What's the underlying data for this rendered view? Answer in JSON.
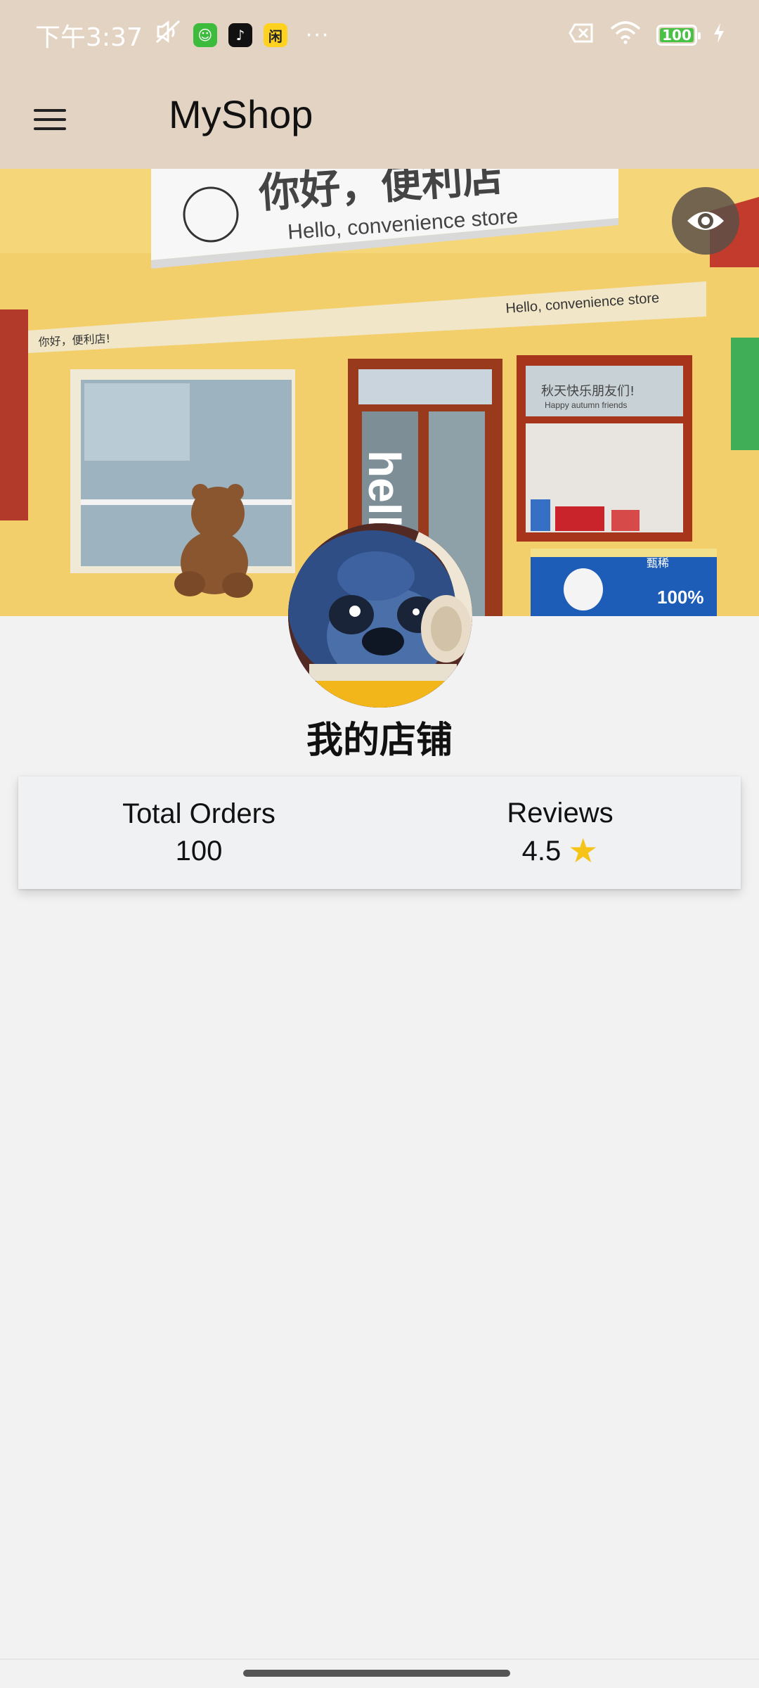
{
  "status_bar": {
    "time": "下午3:37",
    "battery_level": "100",
    "more_dots": "···",
    "icons": [
      "mute-icon",
      "wechat-app-icon",
      "tiktok-app-icon",
      "xianyu-app-icon",
      "sim-off-icon",
      "wifi-icon",
      "battery-icon",
      "charging-icon"
    ]
  },
  "app_bar": {
    "title": "MyShop",
    "menu_icon": "hamburger-menu-icon"
  },
  "cover": {
    "sign_main": "你好，便利店",
    "sign_sub": "Hello, convenience store",
    "awning_text": "Hello, convenience store",
    "awning_left_text": "你好，便利店!",
    "door_text": "hell",
    "window_sign": "秋天快乐朋友们!",
    "window_sign_sub": "Happy autumn friends",
    "freezer_text": "100%",
    "freezer_brand": "甄稀",
    "visibility_icon": "eye-icon"
  },
  "profile": {
    "shop_name": "我的店铺"
  },
  "stats": {
    "orders_label": "Total Orders",
    "orders_value": "100",
    "reviews_label": "Reviews",
    "reviews_value": "4.5"
  },
  "colors": {
    "header_bg": "#e3d3c2",
    "page_bg": "#f2f2f2",
    "card_bg": "#eff1f3",
    "star": "#f6c319",
    "storefront": "#f1cf6a"
  }
}
